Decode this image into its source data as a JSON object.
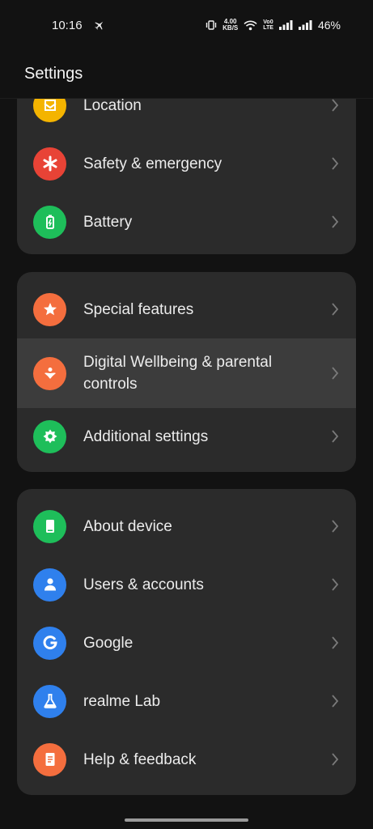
{
  "status_bar": {
    "time": "10:16",
    "net_speed_value": "4.00",
    "net_speed_unit": "KB/S",
    "volte_top": "Vo0",
    "volte_bottom": "LTE",
    "battery": "46%"
  },
  "header": {
    "title": "Settings"
  },
  "groups": [
    {
      "items": [
        {
          "label": "Location",
          "icon": "location-icon",
          "color": "#F4B400"
        },
        {
          "label": "Safety & emergency",
          "icon": "asterisk-icon",
          "color": "#E84336"
        },
        {
          "label": "Battery",
          "icon": "battery-icon",
          "color": "#1EBE5A"
        }
      ]
    },
    {
      "items": [
        {
          "label": "Special features",
          "icon": "star-icon",
          "color": "#F46E3E"
        },
        {
          "label": "Digital Wellbeing & parental controls",
          "icon": "wellbeing-icon",
          "color": "#F46E3E"
        },
        {
          "label": "Additional settings",
          "icon": "gear-icon",
          "color": "#1EBE5A"
        }
      ]
    },
    {
      "items": [
        {
          "label": "About device",
          "icon": "phone-icon",
          "color": "#1EBE5A"
        },
        {
          "label": "Users & accounts",
          "icon": "person-icon",
          "color": "#2F80ED"
        },
        {
          "label": "Google",
          "icon": "google-icon",
          "color": "#2F80ED"
        },
        {
          "label": "realme Lab",
          "icon": "flask-icon",
          "color": "#2F80ED"
        },
        {
          "label": "Help & feedback",
          "icon": "document-icon",
          "color": "#F46E3E"
        }
      ]
    }
  ]
}
